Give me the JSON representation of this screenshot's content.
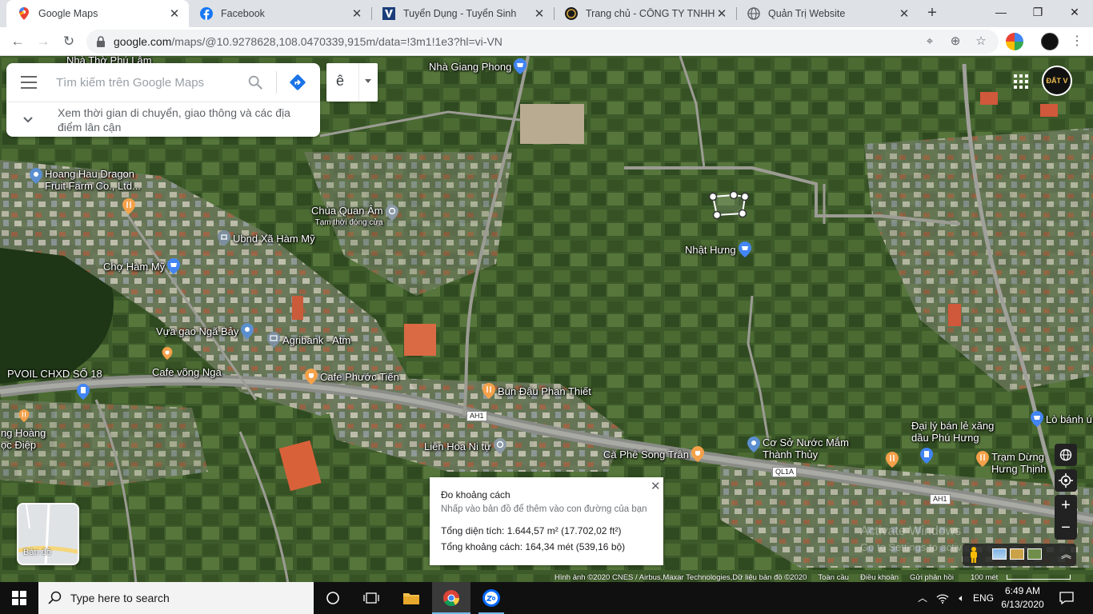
{
  "browser": {
    "tabs": [
      {
        "title": "Google Maps",
        "icon": "google-maps-icon"
      },
      {
        "title": "Facebook",
        "icon": "facebook-icon"
      },
      {
        "title": "Tuyển Dụng - Tuyển Sinh",
        "icon": "tuyen-dung-icon"
      },
      {
        "title": "Trang chủ - CÔNG TY TNHH Đ",
        "icon": "company-logo-icon"
      },
      {
        "title": "Quản Trị Website",
        "icon": "globe-icon"
      }
    ],
    "url_host": "google.com",
    "url_path": "/maps/@10.9278628,108.0470339,915m/data=!3m1!1e3?hl=vi-VN"
  },
  "maps": {
    "search_placeholder": "Tìm kiếm trên Google Maps",
    "suggestion": "Xem thời gian di chuyển, giao thông và các địa điểm lân cận",
    "ime_char": "ê",
    "account_label": "ĐẤT V",
    "layer_label": "Bản đồ",
    "activate_line1": "Activate Windows",
    "activate_line2": "Go to Settings to activate Windows.",
    "distance": {
      "title": "Đo khoảng cách",
      "hint": "Nhấp vào bản đồ để thêm vào con đường của bạn",
      "area": "Tổng diện tích: 1.644,57 m² (17.702,02 ft²)",
      "distance": "Tổng khoảng cách: 164,34 mét (539,16 bộ)"
    },
    "attribution": {
      "imagery": "Hình ảnh ©2020 CNES / Airbus,Maxar Technologies,Dữ liệu bản đồ ©2020",
      "global": "Toàn cầu",
      "terms": "Điều khoản",
      "feedback": "Gửi phản hồi",
      "scale": "100 mét"
    },
    "roads": [
      "AH1",
      "QL1A",
      "AH1"
    ],
    "places": [
      {
        "name": "Nhà Giang Phong",
        "type": "shopping"
      },
      {
        "name": "Hoang Hau Dragon Fruit Farm Co., Ltd...",
        "type": "place"
      },
      {
        "name": "Chùa Quan Âm",
        "sub": "Tạm thời đóng cửa",
        "type": "temple"
      },
      {
        "name": "Ubnd Xã Hàm Mỹ",
        "type": "government"
      },
      {
        "name": "Chợ Hàm Mỹ",
        "type": "shopping"
      },
      {
        "name": "Nhật Hưng",
        "type": "shopping"
      },
      {
        "name": "Vựa gạo Ngã Bảy",
        "type": "place"
      },
      {
        "name": "Agribank - Atm",
        "type": "bank"
      },
      {
        "name": "PVOIL CHXD SỐ 18",
        "type": "gas"
      },
      {
        "name": "Cafe võng Nga",
        "type": "food"
      },
      {
        "name": "Cafe Phước Tiến",
        "type": "food"
      },
      {
        "name": "Bún Đậu Phan Thiết",
        "type": "food"
      },
      {
        "name": "Liên Hoa Ni tự",
        "type": "temple"
      },
      {
        "name": "Cà Phê Song Trân",
        "type": "food"
      },
      {
        "name": "Cơ Sở Nước Mắm Thành Thủy",
        "type": "place"
      },
      {
        "name": "Đại lý bán lẻ xăng dầu Phú Hưng",
        "type": "gas"
      },
      {
        "name": "Trạm Dừng Hưng Thịnh",
        "type": "food"
      },
      {
        "name": "Lò bánh ú",
        "type": "shopping"
      },
      {
        "name": "ng Hoàng ọc Điệp",
        "type": "food"
      },
      {
        "name": "Nhà Thờ Phú Lâm",
        "type": "place"
      }
    ]
  },
  "taskbar": {
    "search_placeholder": "Type here to search",
    "lang": "ENG",
    "time": "6:49 AM",
    "date": "6/13/2020"
  },
  "colors": {
    "accent": "#1a73e8",
    "poi_blue": "#4285f4",
    "poi_orange": "#f4a14a",
    "taskbar": "#101010"
  }
}
